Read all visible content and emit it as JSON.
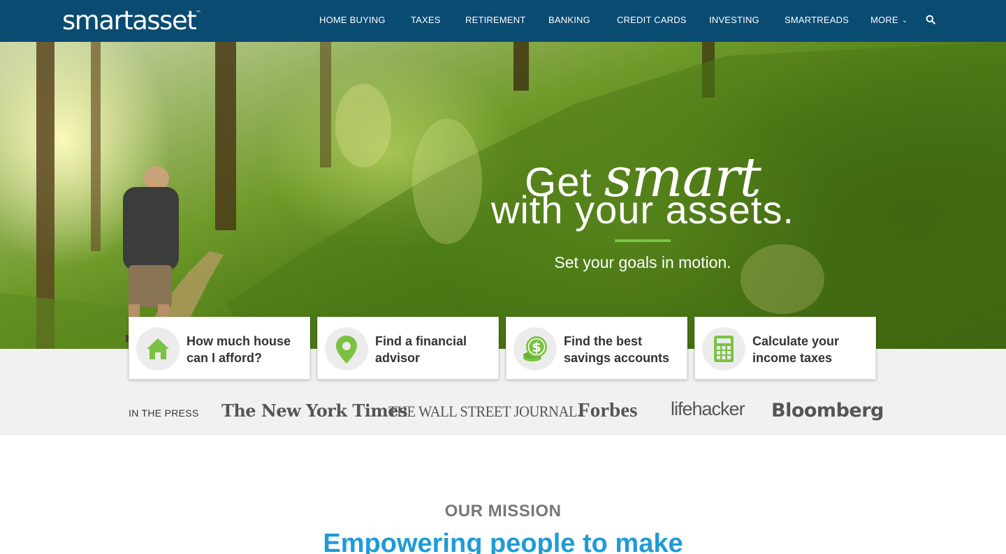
{
  "brand": {
    "logo_text": "smartasset",
    "logo_tm": "™"
  },
  "nav": {
    "items": [
      "HOME BUYING",
      "TAXES",
      "RETIREMENT",
      "BANKING",
      "CREDIT CARDS",
      "INVESTING",
      "SMARTREADS",
      "MORE"
    ],
    "search_icon": "search-icon"
  },
  "hero": {
    "headline_get": "Get",
    "headline_smart": "smart",
    "headline_rest": "with your assets.",
    "tagline": "Set your goals in motion."
  },
  "cards": [
    {
      "label": "How much house can I afford?",
      "icon": "house-icon"
    },
    {
      "label": "Find a financial advisor",
      "icon": "map-pin-icon"
    },
    {
      "label": "Find the best savings accounts",
      "icon": "coins-icon"
    },
    {
      "label": "Calculate your income taxes",
      "icon": "calculator-icon"
    }
  ],
  "press": {
    "label": "IN THE PRESS",
    "logos": [
      "The New York Times",
      "THE WALL STREET JOURNAL.",
      "Forbes",
      "lifehacker",
      "Bloomberg"
    ]
  },
  "mission": {
    "label": "OUR MISSION",
    "title": "Empowering people to make"
  },
  "colors": {
    "header_bg": "#0a4b72",
    "accent_green": "#7bc242",
    "mission_blue": "#1e9bd7",
    "press_band_bg": "#f1f1f1"
  }
}
